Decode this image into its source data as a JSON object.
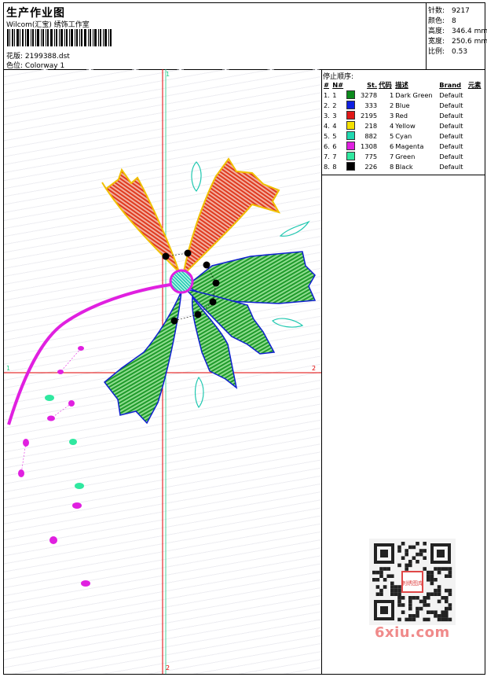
{
  "header": {
    "title": "生产作业图",
    "subtitle": "Wilcom(汇宝) 绣饰工作室",
    "design_label": "花版:",
    "design_file": "2199388.dst",
    "colorway_label": "色位:",
    "colorway": "Colorway 1"
  },
  "stats": [
    {
      "label": "针数:",
      "value": "9217"
    },
    {
      "label": "颜色:",
      "value": "8"
    },
    {
      "label": "高度:",
      "value": "346.4 mm"
    },
    {
      "label": "宽度:",
      "value": "250.6 mm"
    },
    {
      "label": "比例:",
      "value": "0.53"
    }
  ],
  "axes": {
    "left": "1",
    "right": "2",
    "top": "1",
    "bottom": "2"
  },
  "stop_sequence": {
    "title": "停止顺序:",
    "columns": [
      "#",
      "N#",
      "St.",
      "代码",
      "描述",
      "Brand",
      "元素"
    ],
    "rows": [
      {
        "num": "1.",
        "n": "1",
        "color": "#0c8a1c",
        "st": "3278",
        "code": "1",
        "desc": "Dark Green",
        "brand": "Default"
      },
      {
        "num": "2.",
        "n": "2",
        "color": "#1020e0",
        "st": "333",
        "code": "2",
        "desc": "Blue",
        "brand": "Default"
      },
      {
        "num": "3.",
        "n": "3",
        "color": "#e01818",
        "st": "2195",
        "code": "3",
        "desc": "Red",
        "brand": "Default"
      },
      {
        "num": "4.",
        "n": "4",
        "color": "#f4e000",
        "st": "218",
        "code": "4",
        "desc": "Yellow",
        "brand": "Default"
      },
      {
        "num": "5.",
        "n": "5",
        "color": "#20d8b0",
        "st": "882",
        "code": "5",
        "desc": "Cyan",
        "brand": "Default"
      },
      {
        "num": "6.",
        "n": "6",
        "color": "#e020e0",
        "st": "1308",
        "code": "6",
        "desc": "Magenta",
        "brand": "Default"
      },
      {
        "num": "7.",
        "n": "7",
        "color": "#30e8a0",
        "st": "775",
        "code": "7",
        "desc": "Green",
        "brand": "Default"
      },
      {
        "num": "8.",
        "n": "8",
        "color": "#000000",
        "st": "226",
        "code": "8",
        "desc": "Black",
        "brand": "Default"
      }
    ]
  },
  "watermark": "6xiu.com",
  "qr_center_text": "刺绣图库"
}
